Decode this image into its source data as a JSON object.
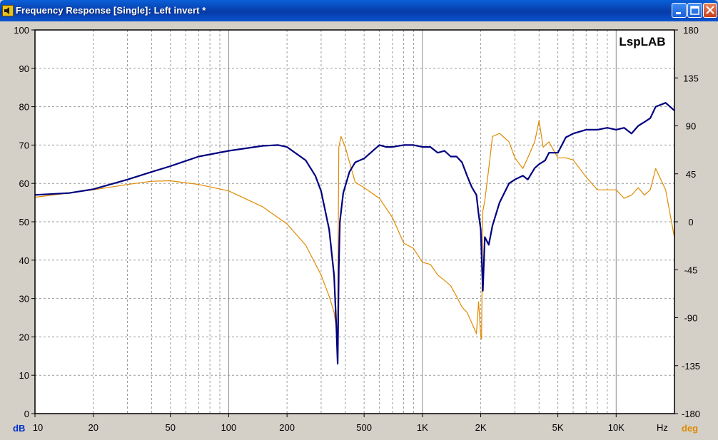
{
  "window": {
    "title": "Frequency Response [Single]: Left invert *",
    "buttons": [
      "minimize",
      "maximize",
      "close"
    ]
  },
  "chart_data": {
    "type": "line",
    "title": "",
    "watermark": "LspLAB",
    "xlabel": "Hz",
    "ylabel_left": "dB",
    "ylabel_right": "deg",
    "xscale": "log",
    "xlim": [
      10,
      20000
    ],
    "ylim_left": [
      0,
      100
    ],
    "ylim_right": [
      -180,
      180
    ],
    "x_ticks": [
      10,
      20,
      50,
      100,
      200,
      500,
      1000,
      2000,
      5000,
      10000
    ],
    "x_tick_labels": [
      "10",
      "20",
      "50",
      "100",
      "200",
      "500",
      "1K",
      "2K",
      "5K",
      "10K"
    ],
    "y_ticks_left": [
      0,
      10,
      20,
      30,
      40,
      50,
      60,
      70,
      80,
      90,
      100
    ],
    "y_tick_labels_left": [
      "0",
      "10",
      "20",
      "30",
      "40",
      "50",
      "60",
      "70",
      "80",
      "90",
      "100"
    ],
    "y_ticks_right": [
      -180,
      -135,
      -90,
      -45,
      0,
      45,
      90,
      135,
      180
    ],
    "y_tick_labels_right": [
      "-180",
      "-135",
      "-90",
      "-45",
      "0",
      "45",
      "90",
      "135",
      "180"
    ],
    "grid": true,
    "colors": {
      "magnitude": "#000080",
      "phase": "#e08a00",
      "plot_bg": "#ffffff",
      "panel_bg": "#d4d0c8",
      "grid": "#808080",
      "dB_label": "#0033cc",
      "deg_label": "#e08a00"
    },
    "series": [
      {
        "axis": "left",
        "unit": "dB",
        "x": [
          10,
          15,
          20,
          30,
          40,
          50,
          70,
          100,
          150,
          180,
          200,
          250,
          280,
          300,
          330,
          350,
          360,
          365,
          370,
          375,
          390,
          420,
          450,
          500,
          600,
          650,
          700,
          800,
          900,
          1000,
          1100,
          1200,
          1300,
          1400,
          1500,
          1600,
          1700,
          1800,
          1900,
          1950,
          2000,
          2050,
          2100,
          2200,
          2300,
          2500,
          2800,
          3000,
          3300,
          3500,
          3800,
          4000,
          4300,
          4500,
          5000,
          5500,
          6000,
          7000,
          8000,
          9000,
          10000,
          11000,
          12000,
          13000,
          14000,
          15000,
          16000,
          18000,
          20000
        ],
        "values": [
          57,
          57.5,
          58.5,
          61,
          63,
          64.5,
          67,
          68.5,
          69.8,
          70,
          69.5,
          66,
          62,
          58,
          48,
          36,
          22,
          13,
          38,
          50,
          57.5,
          63,
          65.5,
          66.5,
          70,
          69.5,
          69.5,
          70,
          70,
          69.5,
          69.5,
          68,
          68.5,
          67,
          67,
          65.5,
          62,
          59,
          57,
          52,
          48,
          32,
          46,
          44,
          49,
          55,
          60,
          61,
          62,
          61,
          64,
          65,
          66,
          68,
          68,
          72,
          73,
          74,
          74,
          74.5,
          74,
          74.5,
          73,
          75,
          76,
          77,
          80,
          81,
          79
        ]
      },
      {
        "axis": "right",
        "unit": "deg",
        "x": [
          10,
          15,
          20,
          30,
          40,
          50,
          70,
          100,
          150,
          200,
          250,
          300,
          330,
          350,
          360,
          365,
          370,
          380,
          400,
          450,
          500,
          600,
          700,
          800,
          900,
          1000,
          1100,
          1200,
          1300,
          1400,
          1500,
          1600,
          1700,
          1800,
          1900,
          1950,
          2000,
          2020,
          2050,
          2100,
          2200,
          2300,
          2500,
          2800,
          3000,
          3300,
          3500,
          3800,
          4000,
          4200,
          4500,
          5000,
          5500,
          6000,
          7000,
          8000,
          9000,
          10000,
          11000,
          12000,
          13000,
          14000,
          15000,
          16000,
          18000,
          20000
        ],
        "values": [
          23,
          27,
          30,
          35,
          38,
          38.5,
          35,
          29,
          14,
          -2,
          -22,
          -50,
          -70,
          -85,
          -100,
          -98,
          70,
          80,
          70,
          37,
          32,
          22,
          4,
          -20,
          -25,
          -38,
          -40,
          -50,
          -55,
          -60,
          -70,
          -80,
          -85,
          -95,
          -105,
          -75,
          -108,
          -110,
          10,
          20,
          50,
          80,
          83,
          75,
          60,
          50,
          60,
          75,
          95,
          70,
          75,
          60,
          60,
          58,
          42,
          30,
          30,
          30,
          22,
          25,
          32,
          25,
          30,
          50,
          30,
          -15
        ]
      }
    ]
  }
}
